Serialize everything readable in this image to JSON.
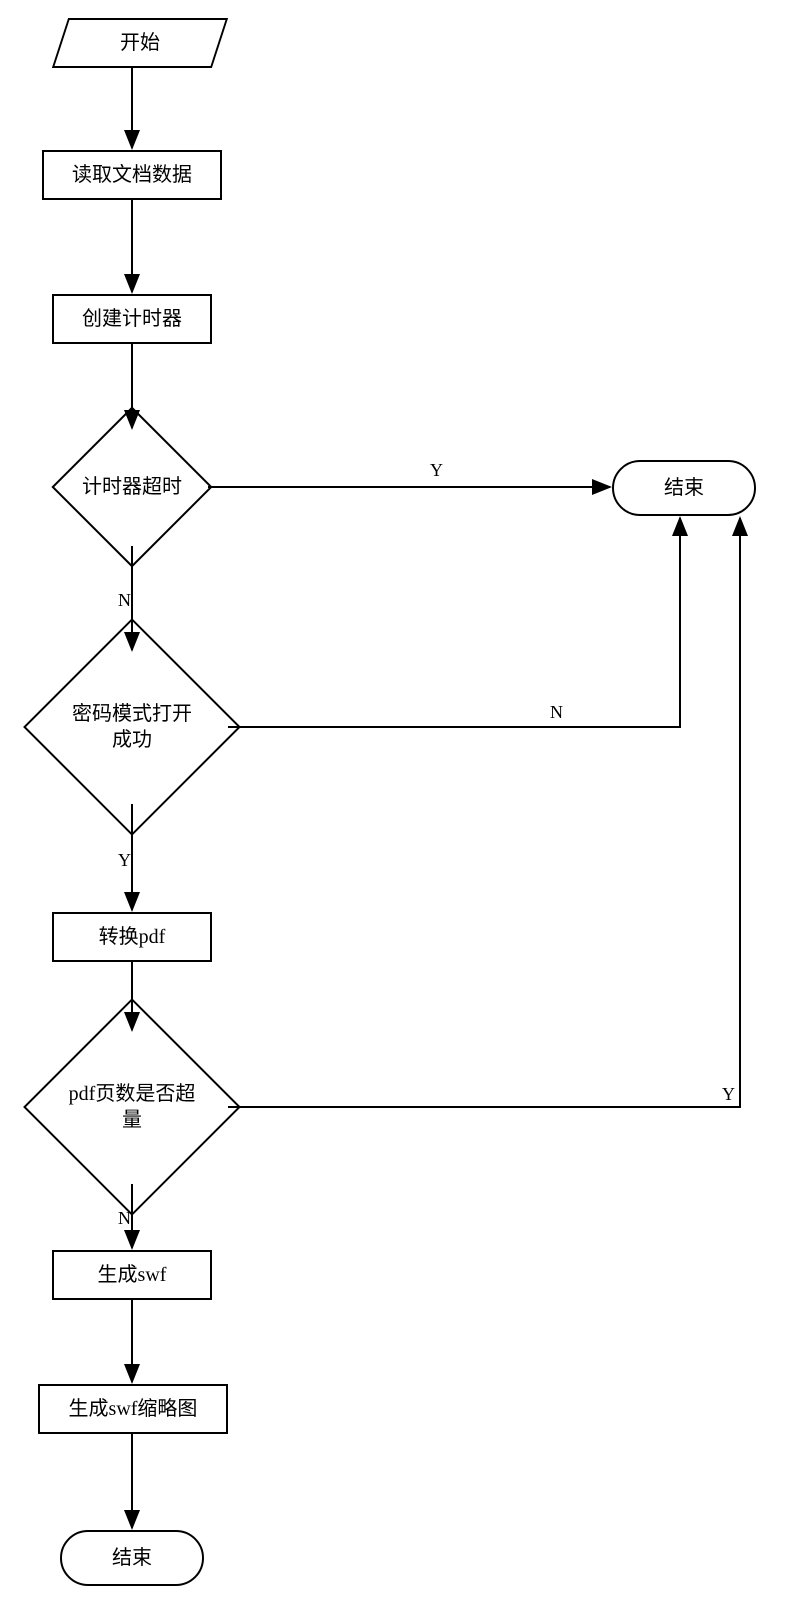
{
  "flowchart": {
    "nodes": {
      "start": {
        "label": "开始",
        "type": "parallelogram"
      },
      "readDoc": {
        "label": "读取文档数据",
        "type": "process"
      },
      "createTimer": {
        "label": "创建计时器",
        "type": "process"
      },
      "timerTimeout": {
        "label": "计时器超时",
        "type": "decision"
      },
      "passwordOpen": {
        "label": "密码模式打开\n成功",
        "type": "decision"
      },
      "convertPdf": {
        "label": "转换pdf",
        "type": "process"
      },
      "pdfPages": {
        "label": "pdf页数是否超\n量",
        "type": "decision"
      },
      "genSwf": {
        "label": "生成swf",
        "type": "process"
      },
      "genSwfThumb": {
        "label": "生成swf缩略图",
        "type": "process"
      },
      "endBottom": {
        "label": "结束",
        "type": "terminator"
      },
      "endRight": {
        "label": "结束",
        "type": "terminator"
      }
    },
    "edges": [
      {
        "from": "start",
        "to": "readDoc",
        "label": ""
      },
      {
        "from": "readDoc",
        "to": "createTimer",
        "label": ""
      },
      {
        "from": "createTimer",
        "to": "timerTimeout",
        "label": ""
      },
      {
        "from": "timerTimeout",
        "to": "endRight",
        "label": "Y",
        "side": "right"
      },
      {
        "from": "timerTimeout",
        "to": "passwordOpen",
        "label": "N",
        "side": "bottom"
      },
      {
        "from": "passwordOpen",
        "to": "convertPdf",
        "label": "Y",
        "side": "bottom"
      },
      {
        "from": "passwordOpen",
        "to": "endRight",
        "label": "N",
        "side": "right"
      },
      {
        "from": "convertPdf",
        "to": "pdfPages",
        "label": ""
      },
      {
        "from": "pdfPages",
        "to": "genSwf",
        "label": "N",
        "side": "bottom"
      },
      {
        "from": "pdfPages",
        "to": "endRight",
        "label": "Y",
        "side": "right"
      },
      {
        "from": "genSwf",
        "to": "genSwfThumb",
        "label": ""
      },
      {
        "from": "genSwfThumb",
        "to": "endBottom",
        "label": ""
      }
    ],
    "edgeLabels": {
      "timerTimeout_Y": "Y",
      "timerTimeout_N": "N",
      "passwordOpen_Y": "Y",
      "passwordOpen_N": "N",
      "pdfPages_N": "N",
      "pdfPages_Y": "Y"
    }
  }
}
